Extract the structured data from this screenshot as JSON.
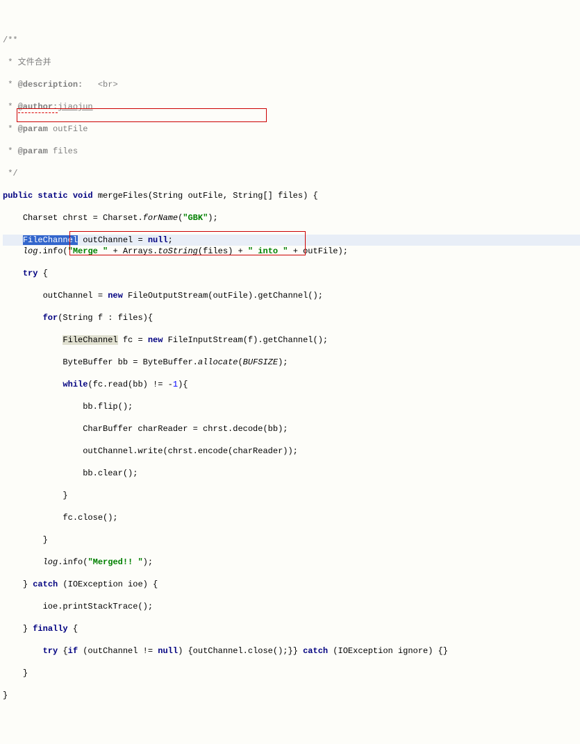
{
  "lines": {
    "0": "/**",
    "1": " * 文件合并",
    "2a": "@description:",
    "2b": "   <br>",
    "3a": "@author:",
    "3b": "jiaojun",
    "4a": "@param",
    "4b": " outFile",
    "5a": "@param",
    "5b": " files",
    "6": " */",
    "7a": "public static void",
    "7b": " mergeFiles(String outFile, String[] files) {",
    "8a": "Charset chrst = Charset.",
    "8b": "forName",
    "8c": "(",
    "8d": "\"GBK\"",
    "8e": ");",
    "9a": "FileChannel",
    "9b": " outChannel = ",
    "9c": "null",
    "9d": ";",
    "10a": "log",
    "10b": ".info(",
    "10c": "\"Merge \"",
    "10d": " + Arrays.",
    "10e": "toString",
    "10f": "(files) + ",
    "10g": "\" into \"",
    "10h": " + outFile);",
    "11a": "try",
    "11b": " {",
    "12a": "outChannel = ",
    "12b": "new",
    "12c": " FileOutputStream(outFile).getChannel();",
    "13a": "for",
    "13b": "(String f : files){",
    "14a": "FileChannel",
    "14b": " fc = ",
    "14c": "new",
    "14d": " FileInputStream(f).getChannel();",
    "15a": "ByteBuffer bb = ByteBuffer.",
    "15b": "allocate",
    "15c": "(",
    "15d": "BUFSIZE",
    "15e": ");",
    "16a": "while",
    "16b": "(fc.read(bb) != -",
    "16c": "1",
    "16d": "){",
    "17": "bb.flip();",
    "18": "CharBuffer charReader = chrst.decode(bb);",
    "19": "outChannel.write(chrst.encode(charReader));",
    "20": "bb.clear();",
    "21": "}",
    "22": "fc.close();",
    "23": "}",
    "24a": "log",
    "24b": ".info(",
    "24c": "\"Merged!! \"",
    "24d": ");",
    "25a": "} ",
    "25b": "catch",
    "25c": " (IOException ioe) {",
    "26": "ioe.printStackTrace();",
    "27a": "} ",
    "27b": "finally",
    "27c": " {",
    "28a": "try",
    "28b": " {",
    "28c": "if",
    "28d": " (outChannel != ",
    "28e": "null",
    "28f": ") {outChannel.close();}} ",
    "28g": "catch",
    "28h": " (IOException ignore) {}",
    "29": "}",
    "30": "}"
  }
}
